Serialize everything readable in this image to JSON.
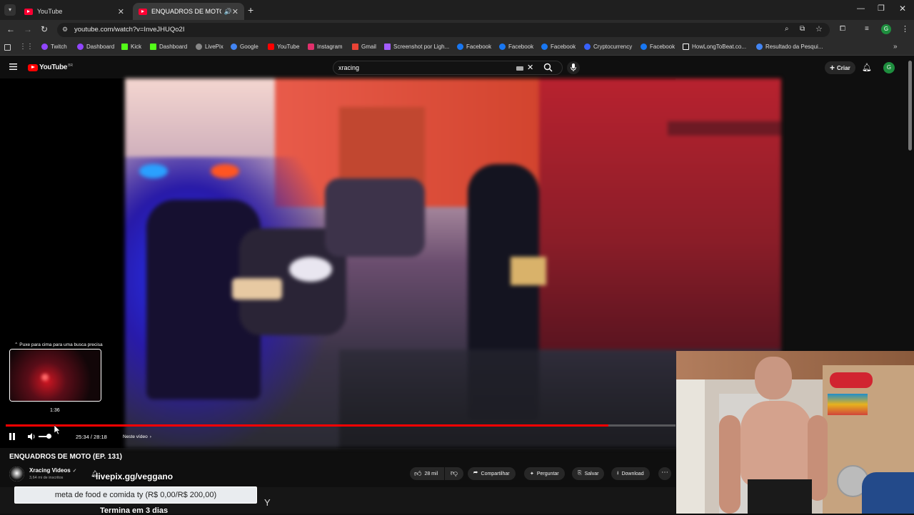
{
  "browser": {
    "tabs": [
      {
        "title": "YouTube",
        "active": false
      },
      {
        "title": "ENQUADROS DE MOTO (EP",
        "active": true
      }
    ],
    "url": "youtube.com/watch?v=InveJHUQo2I",
    "bookmarks": [
      "Twitch",
      "Dashboard",
      "Kick",
      "Dashboard",
      "LivePix",
      "Google",
      "YouTube",
      "Instagram",
      "Gmail",
      "Screenshot por Ligh...",
      "Facebook",
      "Facebook",
      "Facebook",
      "Cryptocurrency",
      "Facebook",
      "HowLongToBeat.co...",
      "Resultado da Pesqui..."
    ]
  },
  "youtube": {
    "logo": "YouTube",
    "logo_country": "BR",
    "search_value": "xracing",
    "create_label": "Criar",
    "avatar_letter": "G"
  },
  "player": {
    "seek_hint": "Puxe para cima para uma busca precisa",
    "preview_time": "1:36",
    "time_display": "25:34 / 28:18",
    "chapter_label": "Neste vídeo",
    "progress": 0.9
  },
  "video": {
    "title": "ENQUADROS DE MOTO (EP. 131)",
    "channel": "Xracing Videos",
    "subscribers": "3,64 mi de inscritos",
    "likes": "28 mil",
    "share_label": "Compartilhar",
    "ask_label": "Perguntar",
    "save_label": "Salvar",
    "download_label": "Download"
  },
  "overlay": {
    "livepix_text": "livepix.gg/veggano",
    "goal_text": "meta de food e comida ty (R$ 0,00/R$ 200,00)",
    "timer_text": "Termina em 3 dias"
  },
  "colors": {
    "accent": "#ff0000",
    "browser_bg": "#1f1f1f",
    "page_bg": "#0f0f0f"
  }
}
